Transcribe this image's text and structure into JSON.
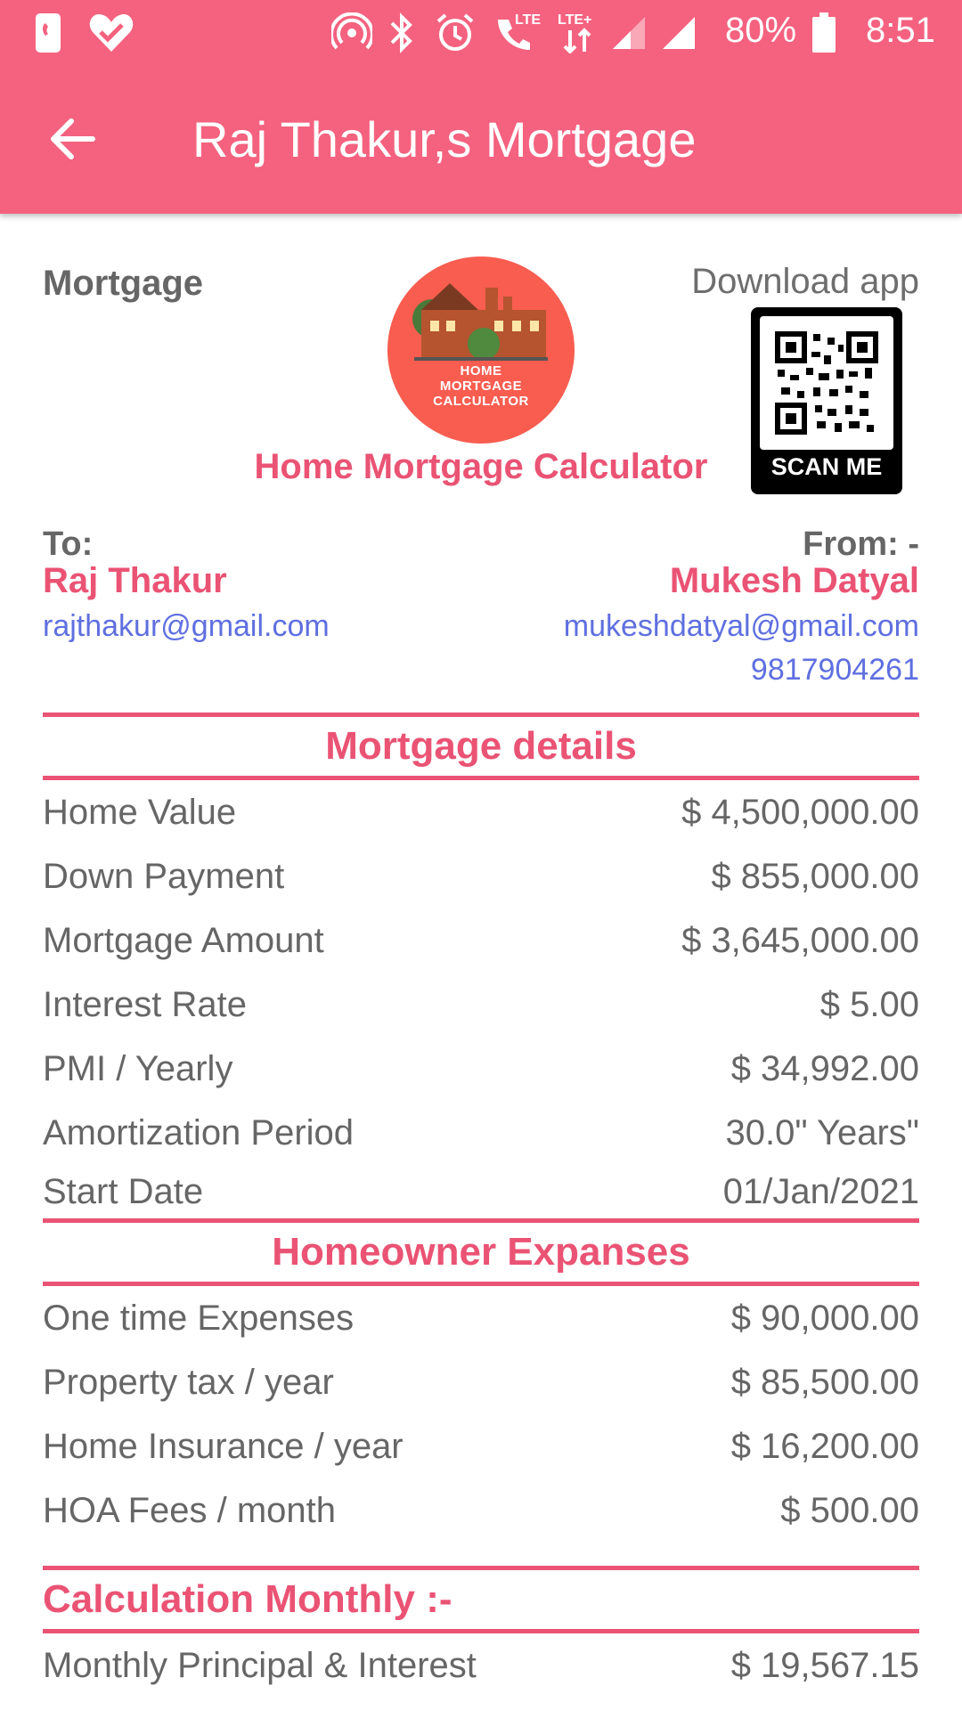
{
  "status_bar": {
    "battery_percent": "80%",
    "time": "8:51",
    "lte_label": "LTE",
    "lte_plus_label": "LTE+",
    "icons": [
      "phone-icon",
      "heart-check-icon",
      "hotspot-icon",
      "bluetooth-icon",
      "alarm-icon",
      "volte-call-icon",
      "data-icon",
      "signal-icon",
      "signal-icon",
      "battery-icon"
    ]
  },
  "app_bar": {
    "title": "Raj Thakur,s Mortgage",
    "back_icon": "arrow-back-icon"
  },
  "header": {
    "label": "Mortgage",
    "logo_text_lines": [
      "HOME",
      "MORTGAGE",
      "CALCULATOR"
    ],
    "brand": "Home Mortgage Calculator",
    "download": "Download app",
    "qr_caption": "SCAN ME"
  },
  "to": {
    "label": "To:",
    "name": "Raj Thakur",
    "email": "rajthakur@gmail.com"
  },
  "from": {
    "label": "From: -",
    "name": "Mukesh Datyal",
    "email": "mukeshdatyal@gmail.com",
    "phone": "9817904261"
  },
  "mortgage_details": {
    "title": "Mortgage details",
    "rows": [
      {
        "label": "Home Value",
        "value": "$ 4,500,000.00"
      },
      {
        "label": "Down Payment",
        "value": "$ 855,000.00"
      },
      {
        "label": "Mortgage Amount",
        "value": "$ 3,645,000.00"
      },
      {
        "label": "Interest Rate",
        "value": "$ 5.00"
      },
      {
        "label": "PMI / Yearly",
        "value": "$ 34,992.00"
      },
      {
        "label": "Amortization Period",
        "value": "30.0\" Years\""
      },
      {
        "label": "Start Date",
        "value": "01/Jan/2021"
      }
    ]
  },
  "homeowner_expenses": {
    "title": "Homeowner Expanses",
    "rows": [
      {
        "label": "One time Expenses",
        "value": "$ 90,000.00"
      },
      {
        "label": "Property tax / year",
        "value": "$ 85,500.00"
      },
      {
        "label": "Home Insurance / year",
        "value": "$ 16,200.00"
      },
      {
        "label": "HOA Fees / month",
        "value": "$ 500.00"
      }
    ]
  },
  "calculation": {
    "title": "Calculation Monthly :-",
    "rows": [
      {
        "label": "Monthly Principal & Interest",
        "value": "$ 19,567.15"
      }
    ]
  },
  "colors": {
    "primary": "#f4627f",
    "accent": "#ea5374",
    "link": "#5f6fe0",
    "text": "#666666",
    "logo_bg": "#f85d50"
  }
}
